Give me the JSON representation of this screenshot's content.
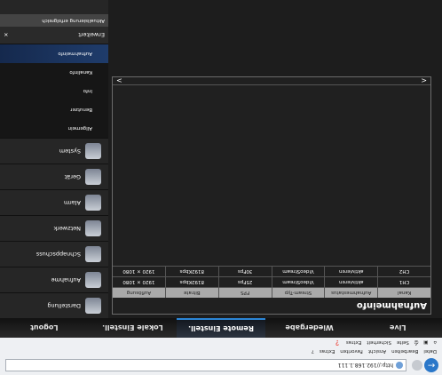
{
  "browser": {
    "address": "http://192.168.1.111",
    "menu": [
      "Datei",
      "Bearbeiten",
      "Ansicht",
      "Favoriten",
      "Extras",
      "?"
    ],
    "toolbar": [
      "Seite",
      "Sicherheit",
      "Extras"
    ]
  },
  "topnav": {
    "tabs": [
      {
        "label": "Live"
      },
      {
        "label": "Wiedergabe"
      },
      {
        "label": "Remote Einstell."
      },
      {
        "label": "Lokale Einstell."
      },
      {
        "label": "Logout"
      }
    ],
    "active_index": 2
  },
  "panel": {
    "title": "Aufnahmeinfo",
    "columns": [
      "Kanal",
      "Aufnahmestatus",
      "Stream-Typ",
      "FPS",
      "Bitrate",
      "Auflösung"
    ],
    "rows": [
      [
        "CH1",
        "aktivieren",
        "VideoStream",
        "25Fps",
        "8192Kbps",
        "1920 × 1080"
      ],
      [
        "CH2",
        "aktivieren",
        "VideoStream",
        "30Fps",
        "8192Kbps",
        "1920 × 1080"
      ]
    ],
    "arrow_left": "<",
    "arrow_right": ">"
  },
  "sidebar": {
    "items": [
      {
        "label": "Darstellung",
        "icon": "monitor-icon"
      },
      {
        "label": "Aufnahme",
        "icon": "film-reel-icon"
      },
      {
        "label": "Schnappschuss",
        "icon": "camera-icon"
      },
      {
        "label": "Netzwerk",
        "icon": "network-icon"
      },
      {
        "label": "Alarm",
        "icon": "alarm-icon"
      },
      {
        "label": "Gerät",
        "icon": "hdd-icon"
      },
      {
        "label": "System",
        "icon": "system-icon"
      }
    ],
    "subitems": [
      {
        "label": "Allgemein"
      },
      {
        "label": "Benutzer"
      },
      {
        "label": "Info"
      },
      {
        "label": "Kanalinfo"
      },
      {
        "label": "Aufnahmeinfo"
      }
    ],
    "active_sub_index": 4,
    "bottom_label": "Erweitert",
    "close_glyph": "×",
    "status": "Aktualisierung erfolgreich"
  }
}
